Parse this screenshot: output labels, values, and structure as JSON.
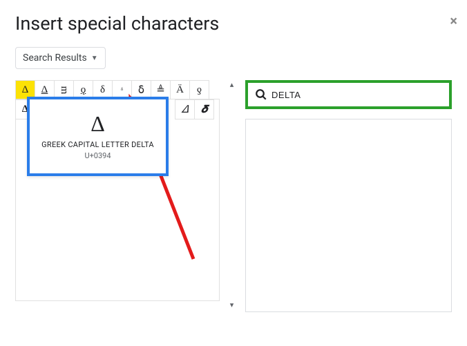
{
  "dialog": {
    "title": "Insert special characters",
    "dropdown_label": "Search Results"
  },
  "search": {
    "value": "DELTA"
  },
  "tooltip": {
    "glyph": "Δ",
    "name": "GREEK CAPITAL LETTER DELTA",
    "code": "U+0394"
  },
  "chars_row1": [
    "Δ",
    "Δ",
    "ᴟ",
    "ǫ",
    "δ",
    "ᵟ",
    "ẟ",
    "≜",
    "Ä",
    "ƍ"
  ],
  "chars_row2_visible": [
    "Δ"
  ],
  "chars_row2_right": [
    "𝛥",
    "𝜹"
  ]
}
